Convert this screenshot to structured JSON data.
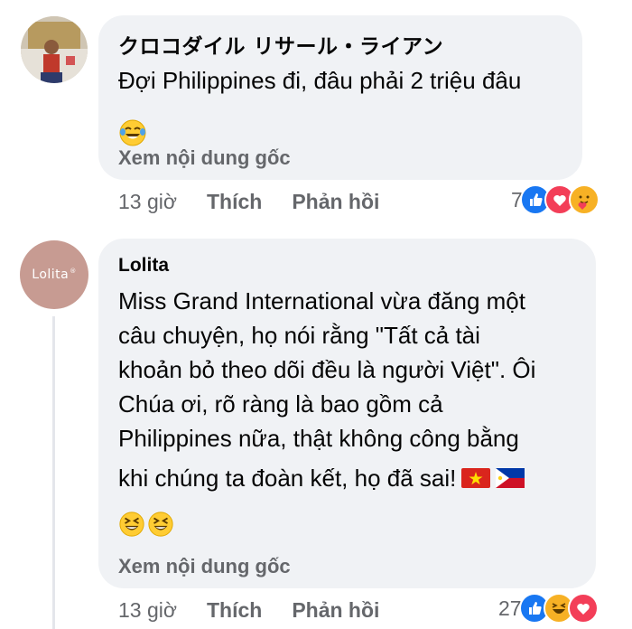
{
  "comments": [
    {
      "author": "クロコダイル リサール・ライアン",
      "text_lines": [
        "Đợi Philippines đi, đâu phải 2 triệu đâu"
      ],
      "emojis": [
        "face-with-tears-of-joy"
      ],
      "see_original": "Xem nội dung gốc",
      "time": "13 giờ",
      "like_label": "Thích",
      "reply_label": "Phản hồi",
      "reaction_count": "7",
      "reactions": [
        "like",
        "love",
        "care"
      ]
    },
    {
      "author": "Lolita",
      "avatar_text": "Lolita",
      "text_lines": [
        "Miss Grand International vừa đăng một",
        "câu chuyện, họ nói rằng \"Tất cả tài",
        "khoản bỏ theo dõi đều là người Việt\". Ôi",
        "Chúa ơi, rõ ràng là bao gồm cả",
        "Philippines nữa, thật không công bằng",
        "khi chúng ta đoàn kết, họ đã sai!"
      ],
      "inline_flags": [
        "vietnam-flag",
        "philippines-flag"
      ],
      "emojis": [
        "grinning-squinting-face",
        "grinning-squinting-face"
      ],
      "see_original": "Xem nội dung gốc",
      "time": "13 giờ",
      "like_label": "Thích",
      "reply_label": "Phản hồi",
      "reaction_count": "27",
      "reactions": [
        "like",
        "haha",
        "love"
      ]
    }
  ],
  "colors": {
    "bubble": "#f0f2f5",
    "meta_text": "#65676b",
    "like": "#1877f2",
    "love": "#f33e58",
    "haha": "#f7b125"
  }
}
